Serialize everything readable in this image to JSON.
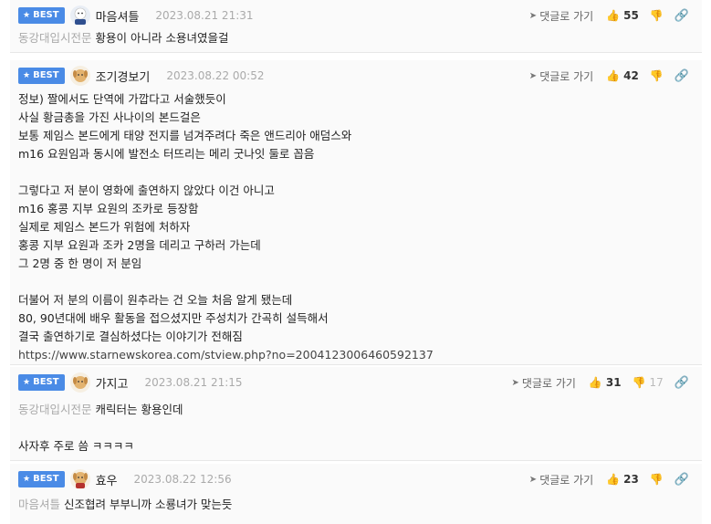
{
  "badge_label": "BEST",
  "reply_label": "댓글로 가기",
  "comments": [
    {
      "nick": "마음셔틀",
      "date": "2023.08.21 21:31",
      "up": "55",
      "reply_to": "동강대입시전문",
      "lines": [
        "황용이 아니라 소용녀였을걸"
      ]
    },
    {
      "nick": "조기경보기",
      "date": "2023.08.22 00:52",
      "up": "42",
      "lines": [
        "정보) 짤에서도 단역에 가깝다고 서술했듯이",
        "사실 황금총을 가진 사나이의 본드걸은",
        "보통 제임스 본드에게 태양 전지를 넘겨주려다 죽은 앤드리아 애덤스와",
        "m16 요원임과 동시에 발전소 터뜨리는 메리 굿나잇 둘로 꼽음",
        "",
        "그렇다고 저 분이 영화에 출연하지 않았다 이건 아니고",
        "m16 홍콩 지부 요원의 조카로 등장함",
        "실제로 제임스 본드가 위험에 처하자",
        "홍콩 지부 요원과 조카 2명을 데리고 구하러 가는데",
        "그 2명 중 한 명이 저 분임",
        "",
        "더불어 저 분의 이름이 원추라는 건 오늘 처음 알게 됐는데",
        "80, 90년대에 배우 활동을 접으셨지만 주성치가 간곡히 설득해서",
        "결국 출연하기로 결심하셨다는 이야기가 전해짐"
      ],
      "url": "https://www.starnewskorea.com/stview.php?no=2004123006460592137"
    },
    {
      "nick": "가지고",
      "date": "2023.08.21 21:15",
      "up": "31",
      "down": "17",
      "reply_to": "동강대입시전문",
      "lines": [
        "캐릭터는 황용인데",
        "",
        "사자후 주로 씀 ㅋㅋㅋㅋ"
      ]
    },
    {
      "nick": "효우",
      "date": "2023.08.22 12:56",
      "up": "23",
      "reply_to": "마음셔틀",
      "lines": [
        "신조협려 부부니까 소룡녀가 맞는듯"
      ]
    }
  ]
}
